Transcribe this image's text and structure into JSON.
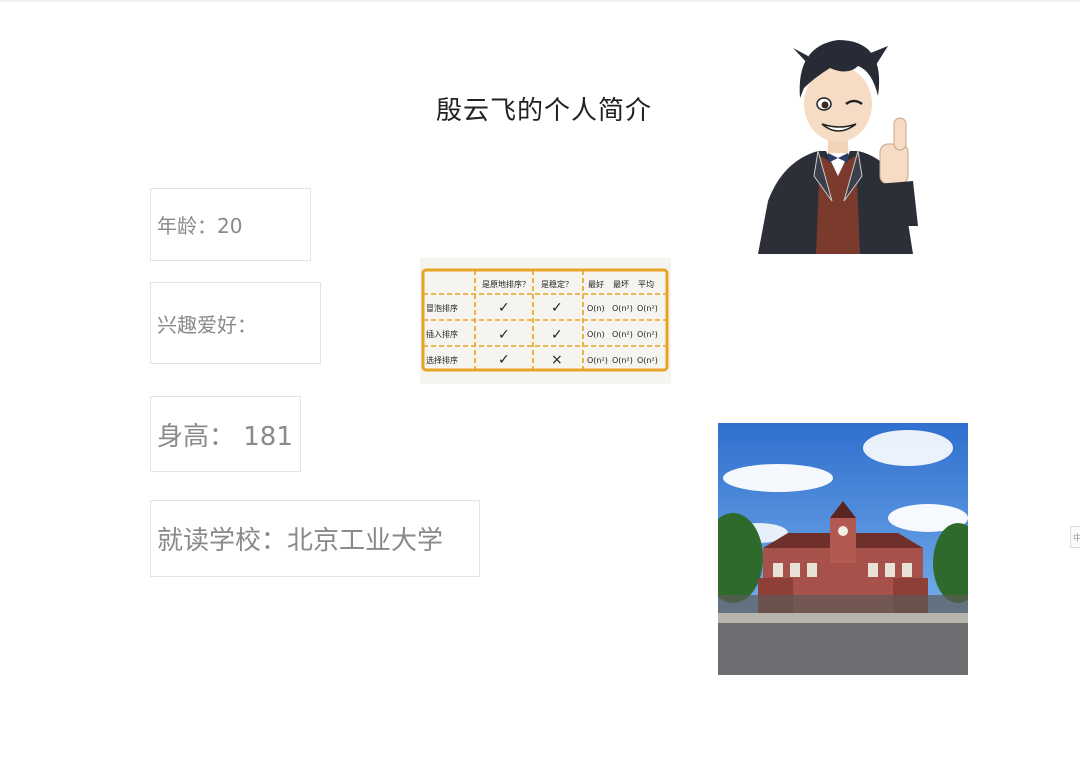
{
  "header": {
    "title": "殷云飞的个人简介"
  },
  "profile": {
    "age": "年龄：20",
    "hobbies": "兴趣爱好：",
    "height": "身高： 181",
    "school": "就读学校：北京工业大学"
  },
  "sort_table": {
    "columns": [
      "是原地排序？",
      "是稳定？",
      "最好",
      "最坏",
      "平均"
    ],
    "rows": [
      {
        "name": "冒泡排序",
        "in_place": "✓",
        "stable": "✓",
        "best": "O(n)",
        "worst": "O(n²)",
        "avg": "O(n²)"
      },
      {
        "name": "插入排序",
        "in_place": "✓",
        "stable": "✓",
        "best": "O(n)",
        "worst": "O(n²)",
        "avg": "O(n²)"
      },
      {
        "name": "选择排序",
        "in_place": "✓",
        "stable": "×",
        "best": "O(n²)",
        "worst": "O(n²)",
        "avg": "O(n²)"
      }
    ],
    "border_color": "#e8a325"
  },
  "edge_tab": {
    "label": "中"
  },
  "colors": {
    "sky": "#3d7fd6",
    "building": "#a6524a",
    "road": "#6d6d72"
  }
}
